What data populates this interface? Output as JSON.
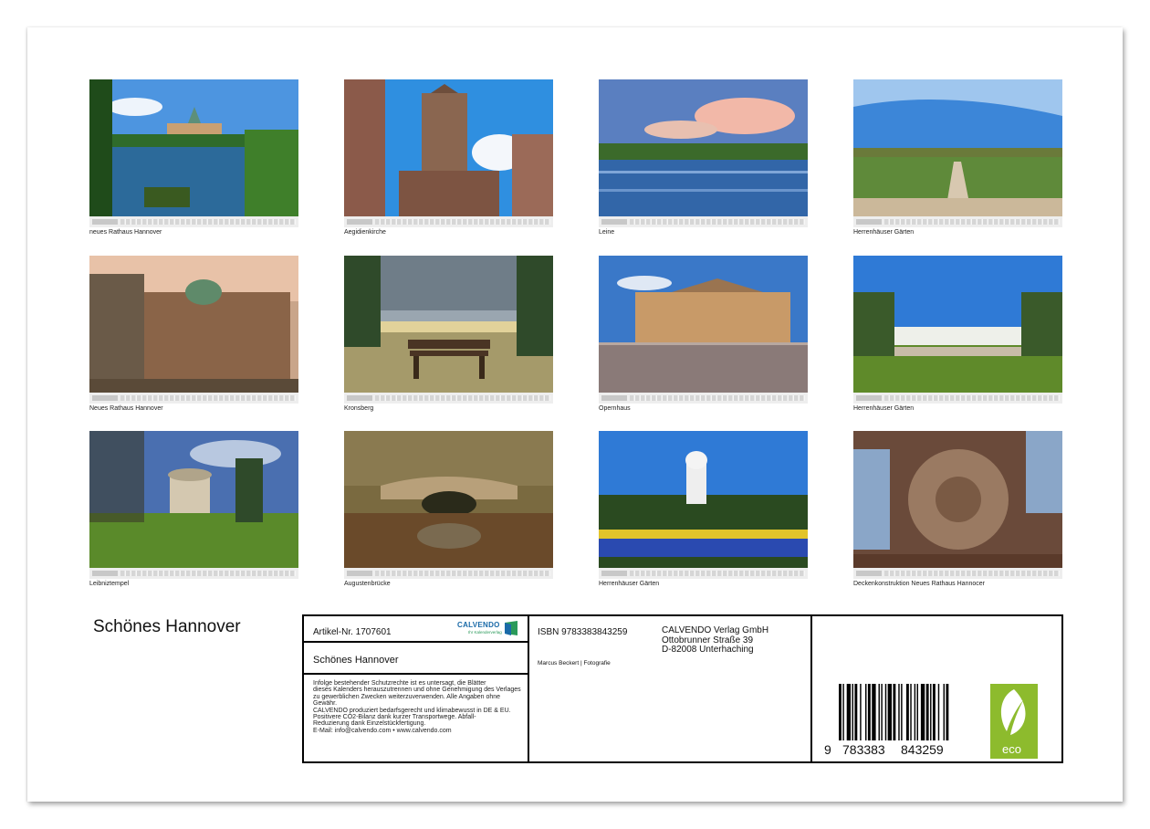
{
  "calendar_title": "Schönes Hannover",
  "months": [
    {
      "label": "Januar 2025",
      "caption": "neues Rathaus Hannover"
    },
    {
      "label": "Februar 2025",
      "caption": "Aegidienkirche"
    },
    {
      "label": "März 2025",
      "caption": "Leine"
    },
    {
      "label": "April 2025",
      "caption": "Herrenhäuser Gärten"
    },
    {
      "label": "Mai 2025",
      "caption": "Neues Rathaus Hannover"
    },
    {
      "label": "Juni 2025",
      "caption": "Kronsberg"
    },
    {
      "label": "Juli 2025",
      "caption": "Opernhaus"
    },
    {
      "label": "August 2025",
      "caption": "Herrenhäuser Gärten"
    },
    {
      "label": "September 2025",
      "caption": "Leibniztempel"
    },
    {
      "label": "Oktober 2025",
      "caption": "Augustenbrücke"
    },
    {
      "label": "November 2025",
      "caption": "Herrenhäuser Gärten"
    },
    {
      "label": "Dezember 2025",
      "caption": "Deckenkonstruktion Neues Rathaus Hannocer"
    }
  ],
  "info": {
    "article": "Artikel-Nr. 1707601",
    "brand": "CALVENDO",
    "brand_sub": "Ihr Kalenderverlag",
    "product_title": "Schönes Hannover",
    "legal_lines": [
      "Infolge bestehender Schutzrechte ist es untersagt, die Blätter",
      "dieses Kalenders herauszutrennen und ohne Genehmigung des Verlages",
      "zu gewerblichen Zwecken weiterzuverwenden. Alle Angaben ohne",
      "Gewähr.",
      "CALVENDO produziert bedarfsgerecht und klimabewusst in DE & EU.",
      "Positivere CO2-Bilanz dank kurzer Transportwege. Abfall-",
      "Reduzierung dank Einzelstückfertigung.",
      "E-Mail: info@calvendo.com • www.calvendo.com"
    ],
    "isbn": "ISBN 9783383843259",
    "author": "Marcus Beckert | Fotografie",
    "publisher_lines": [
      "CALVENDO Verlag GmbH",
      "Ottobrunner Straße 39",
      "D-82008 Unterhaching"
    ],
    "barcode_prefix": "9",
    "barcode_group1": "783383",
    "barcode_group2": "843259",
    "eco_label": "eco"
  },
  "colors": {
    "eco_green": "#8dbb2d",
    "brand_blue": "#1a6aa8",
    "brand_green": "#2a9a5a"
  }
}
